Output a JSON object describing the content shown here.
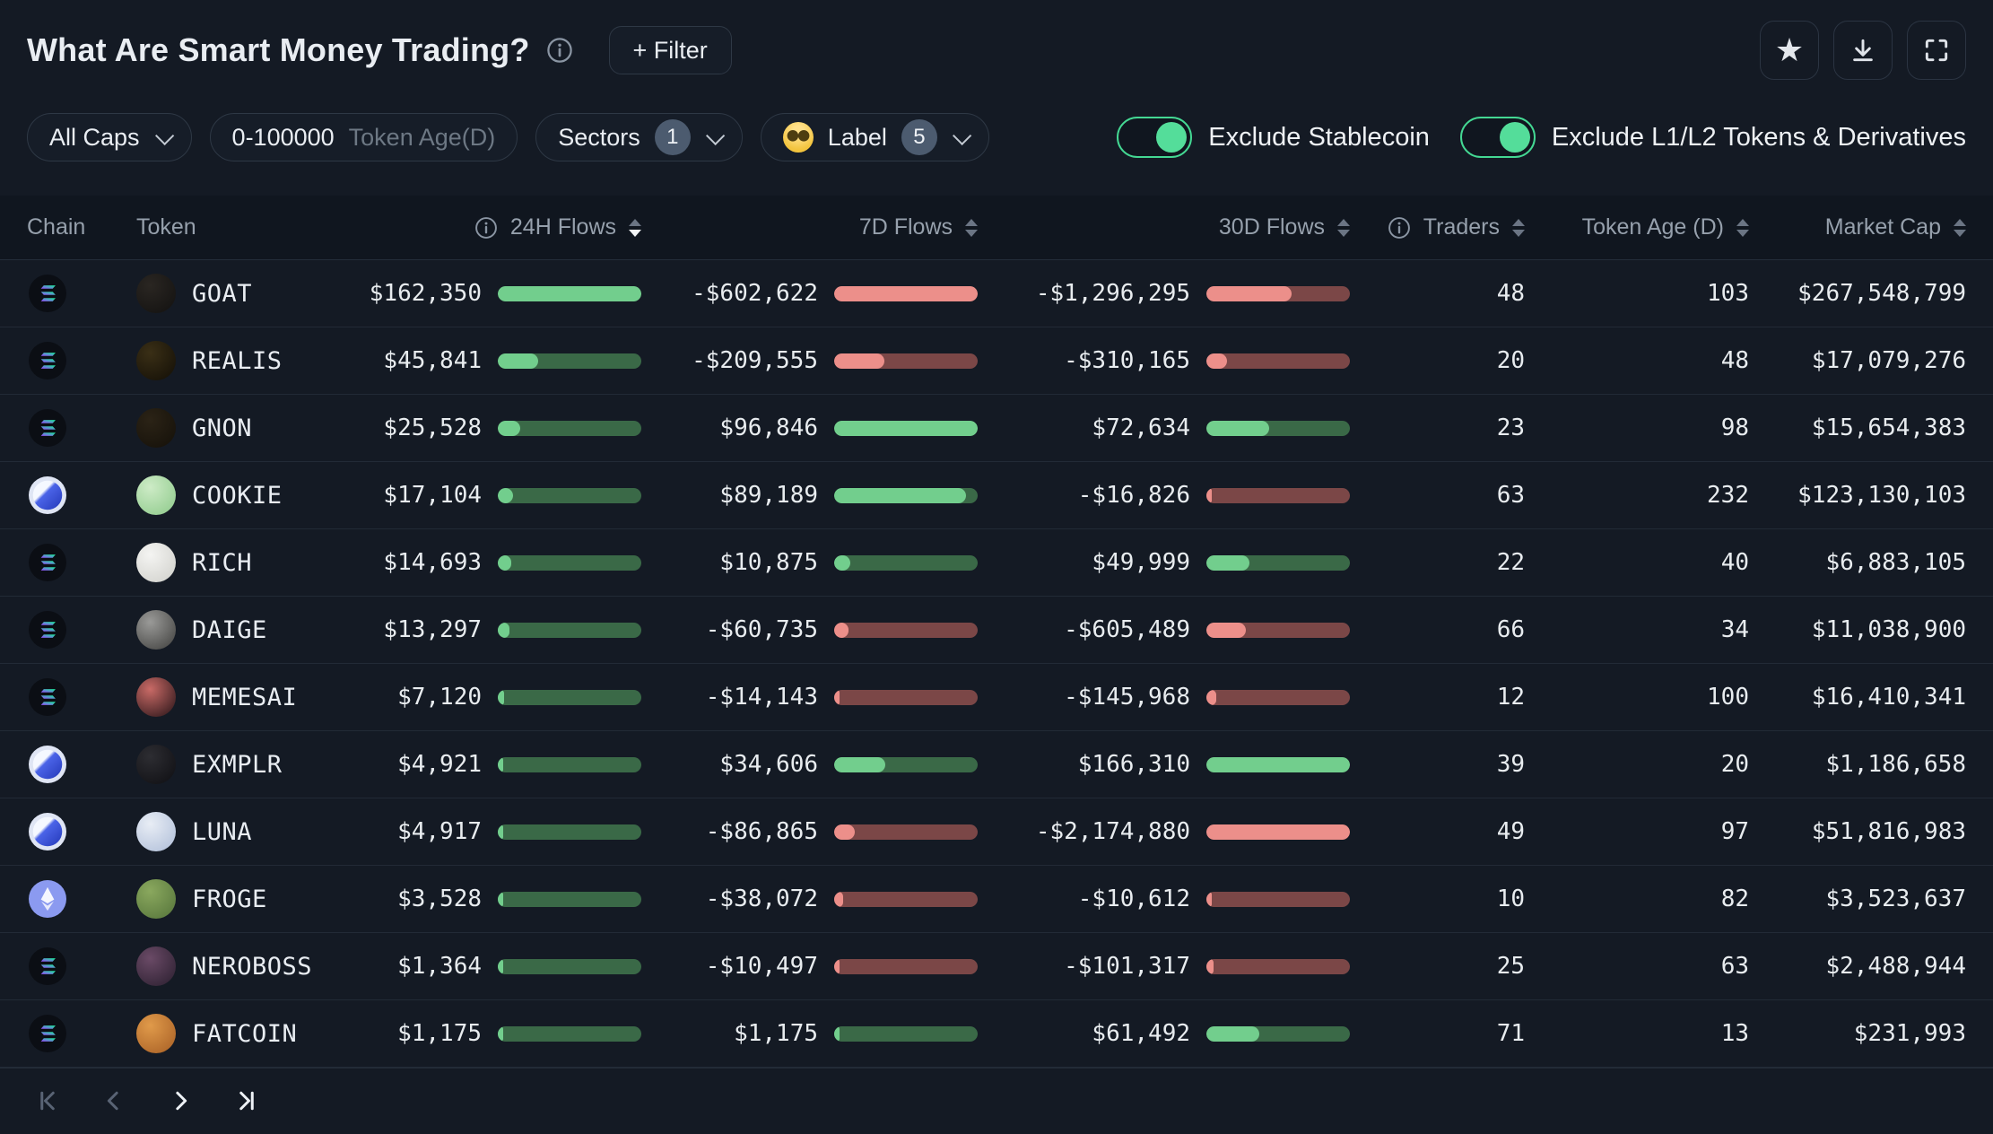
{
  "header": {
    "title": "What Are Smart Money Trading?",
    "filter_button": "+ Filter"
  },
  "filters": {
    "market_cap": {
      "label": "All Caps"
    },
    "token_age": {
      "value": "0-100000",
      "placeholder": "Token Age(D)"
    },
    "sectors": {
      "label": "Sectors",
      "count": "1"
    },
    "smart_money_label": {
      "label": "Label",
      "count": "5"
    }
  },
  "toggles": [
    {
      "label": "Exclude Stablecoin",
      "on": true
    },
    {
      "label": "Exclude L1/L2 Tokens & Derivatives",
      "on": true
    }
  ],
  "table": {
    "columns": [
      {
        "label": "Chain",
        "sort": "none"
      },
      {
        "label": "Token",
        "sort": "none"
      },
      {
        "label": "24H Flows",
        "info": true,
        "sort": "desc"
      },
      {
        "label": "7D Flows",
        "sort": "none"
      },
      {
        "label": "30D Flows",
        "sort": "none"
      },
      {
        "label": "Traders",
        "info": true,
        "sort": "none"
      },
      {
        "label": "Token Age (D)",
        "sort": "none"
      },
      {
        "label": "Market Cap",
        "sort": "none"
      }
    ],
    "rows": [
      {
        "chain": "solana",
        "token": "GOAT",
        "flow24": {
          "text": "$162,350",
          "value": 162350
        },
        "flow7": {
          "text": "-$602,622",
          "value": -602622
        },
        "flow30": {
          "text": "-$1,296,295",
          "value": -1296295
        },
        "traders": "48",
        "token_age": "103",
        "market_cap": "$267,548,799",
        "icon": [
          "#2a2622",
          "#121110"
        ]
      },
      {
        "chain": "solana",
        "token": "REALIS",
        "flow24": {
          "text": "$45,841",
          "value": 45841
        },
        "flow7": {
          "text": "-$209,555",
          "value": -209555
        },
        "flow30": {
          "text": "-$310,165",
          "value": -310165
        },
        "traders": "20",
        "token_age": "48",
        "market_cap": "$17,079,276",
        "icon": [
          "#3a2f16",
          "#120e06"
        ]
      },
      {
        "chain": "solana",
        "token": "GNON",
        "flow24": {
          "text": "$25,528",
          "value": 25528
        },
        "flow7": {
          "text": "$96,846",
          "value": 96846
        },
        "flow30": {
          "text": "$72,634",
          "value": 72634
        },
        "traders": "23",
        "token_age": "98",
        "market_cap": "$15,654,383",
        "icon": [
          "#2b2316",
          "#141009"
        ]
      },
      {
        "chain": "base",
        "token": "COOKIE",
        "flow24": {
          "text": "$17,104",
          "value": 17104
        },
        "flow7": {
          "text": "$89,189",
          "value": 89189
        },
        "flow30": {
          "text": "-$16,826",
          "value": -16826
        },
        "traders": "63",
        "token_age": "232",
        "market_cap": "$123,130,103",
        "icon": [
          "#cdebc6",
          "#8cc989"
        ]
      },
      {
        "chain": "solana",
        "token": "RICH",
        "flow24": {
          "text": "$14,693",
          "value": 14693
        },
        "flow7": {
          "text": "$10,875",
          "value": 10875
        },
        "flow30": {
          "text": "$49,999",
          "value": 49999
        },
        "traders": "22",
        "token_age": "40",
        "market_cap": "$6,883,105",
        "icon": [
          "#f4f4f2",
          "#cfcfca"
        ]
      },
      {
        "chain": "solana",
        "token": "DAIGE",
        "flow24": {
          "text": "$13,297",
          "value": 13297
        },
        "flow7": {
          "text": "-$60,735",
          "value": -60735
        },
        "flow30": {
          "text": "-$605,489",
          "value": -605489
        },
        "traders": "66",
        "token_age": "34",
        "market_cap": "$11,038,900",
        "icon": [
          "#9a9a98",
          "#3e3e3c"
        ]
      },
      {
        "chain": "solana",
        "token": "MEMESAI",
        "flow24": {
          "text": "$7,120",
          "value": 7120
        },
        "flow7": {
          "text": "-$14,143",
          "value": -14143
        },
        "flow30": {
          "text": "-$145,968",
          "value": -145968
        },
        "traders": "12",
        "token_age": "100",
        "market_cap": "$16,410,341",
        "icon": [
          "#c96a66",
          "#241216"
        ]
      },
      {
        "chain": "base",
        "token": "EXMPLR",
        "flow24": {
          "text": "$4,921",
          "value": 4921
        },
        "flow7": {
          "text": "$34,606",
          "value": 34606
        },
        "flow30": {
          "text": "$166,310",
          "value": 166310
        },
        "traders": "39",
        "token_age": "20",
        "market_cap": "$1,186,658",
        "icon": [
          "#2d2d32",
          "#0e0e12"
        ]
      },
      {
        "chain": "base",
        "token": "LUNA",
        "flow24": {
          "text": "$4,917",
          "value": 4917
        },
        "flow7": {
          "text": "-$86,865",
          "value": -86865
        },
        "flow30": {
          "text": "-$2,174,880",
          "value": -2174880
        },
        "traders": "49",
        "token_age": "97",
        "market_cap": "$51,816,983",
        "icon": [
          "#e8edf5",
          "#aebdd8"
        ]
      },
      {
        "chain": "ethereum",
        "token": "FROGE",
        "flow24": {
          "text": "$3,528",
          "value": 3528
        },
        "flow7": {
          "text": "-$38,072",
          "value": -38072
        },
        "flow30": {
          "text": "-$10,612",
          "value": -10612
        },
        "traders": "10",
        "token_age": "82",
        "market_cap": "$3,523,637",
        "icon": [
          "#8aa85e",
          "#54733a"
        ]
      },
      {
        "chain": "solana",
        "token": "NEROBOSS",
        "flow24": {
          "text": "$1,364",
          "value": 1364
        },
        "flow7": {
          "text": "-$10,497",
          "value": -10497
        },
        "flow30": {
          "text": "-$101,317",
          "value": -101317
        },
        "traders": "25",
        "token_age": "63",
        "market_cap": "$2,488,944",
        "icon": [
          "#6a4a66",
          "#291e2e"
        ]
      },
      {
        "chain": "solana",
        "token": "FATCOIN",
        "flow24": {
          "text": "$1,175",
          "value": 1175
        },
        "flow7": {
          "text": "$1,175",
          "value": 1175
        },
        "flow30": {
          "text": "$61,492",
          "value": 61492
        },
        "traders": "71",
        "token_age": "13",
        "market_cap": "$231,993",
        "icon": [
          "#e09a4a",
          "#a65e24"
        ]
      }
    ]
  },
  "pagination": {
    "first_enabled": false,
    "prev_enabled": false,
    "next_enabled": true,
    "last_enabled": true
  },
  "colors": {
    "background": "#141a24",
    "positive_fill": "#72ce8d",
    "positive_track": "#3a6947",
    "negative_fill": "#ec8f8a",
    "negative_track": "#7b4747",
    "toggle_on": "#54dd9a"
  }
}
